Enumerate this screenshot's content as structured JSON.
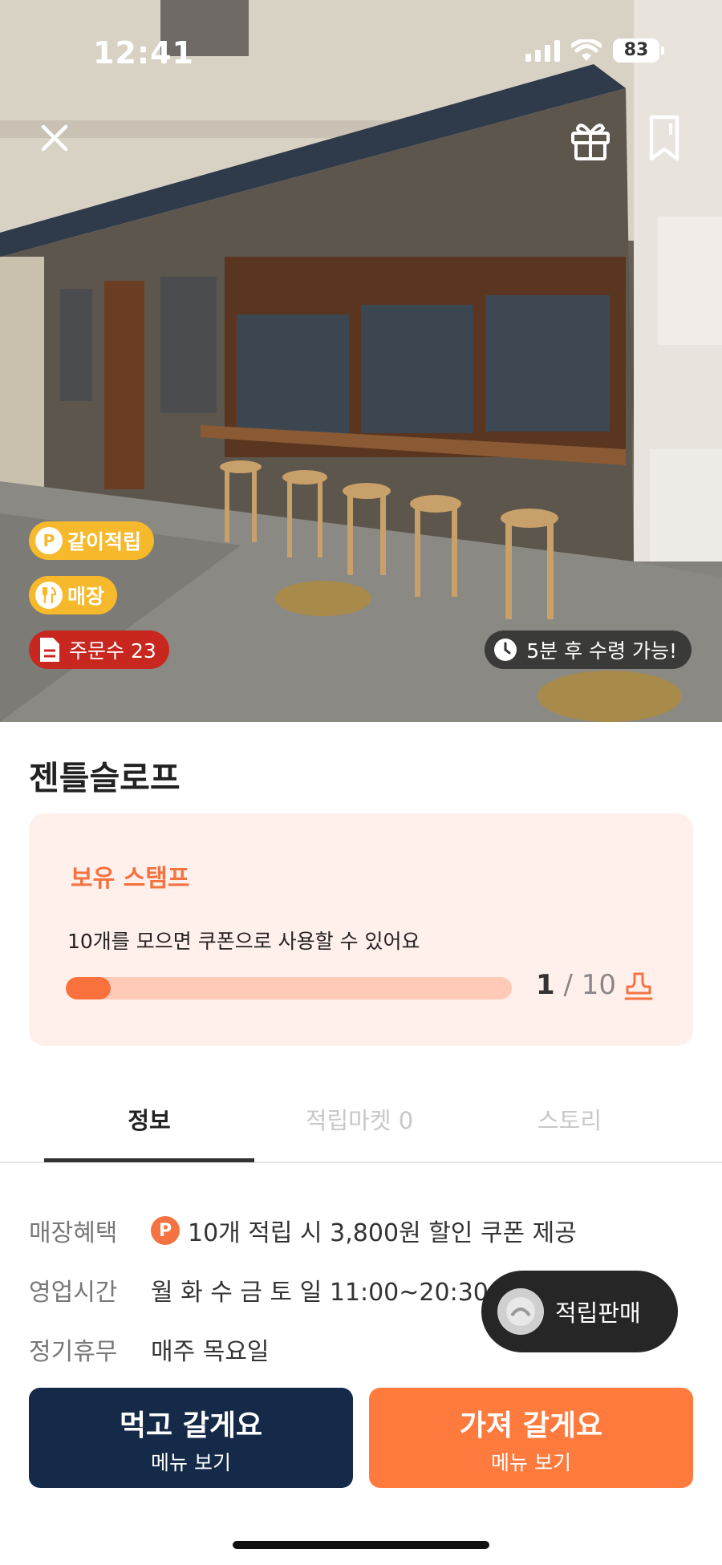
{
  "status_bar": {
    "time": "12:41",
    "battery": "83"
  },
  "header": {
    "close_icon": "close-icon",
    "gift_icon": "gift-icon",
    "bookmark_icon": "bookmark-icon"
  },
  "hero": {
    "tags": [
      {
        "label": "같이적립",
        "icon": "P"
      },
      {
        "label": "매장",
        "icon": "fork-spoon-icon"
      },
      {
        "label": "주문수 23",
        "icon": "document-icon"
      }
    ],
    "pickup": "5분 후 수령 가능!"
  },
  "store": {
    "name": "젠틀슬로프"
  },
  "stamp": {
    "title": "보유 스탬프",
    "description": "10개를 모으면 쿠폰으로 사용할 수 있어요",
    "current": "1",
    "separator": " / ",
    "total": "10",
    "progress_fraction": 0.1,
    "accent": "#f47340"
  },
  "tabs": [
    {
      "label": "정보",
      "active": true
    },
    {
      "label": "적립마켓 0",
      "active": false
    },
    {
      "label": "스토리",
      "active": false
    }
  ],
  "info": {
    "benefit": {
      "label": "매장혜택",
      "value": "10개 적립 시 3,800원 할인 쿠폰 제공",
      "badge": "P"
    },
    "hours": {
      "label": "영업시간",
      "value": "월 화 수 금 토 일  11:00~20:30"
    },
    "holiday": {
      "label": "정기휴무",
      "value": "매주 목요일"
    }
  },
  "floating": {
    "sell_label": "적립판매"
  },
  "actions": {
    "eat_in": {
      "label": "먹고 갈게요",
      "sub": "메뉴 보기",
      "color": "#142a48"
    },
    "take_out": {
      "label": "가져 갈게요",
      "sub": "메뉴 보기",
      "color": "#ff7a3d"
    }
  }
}
